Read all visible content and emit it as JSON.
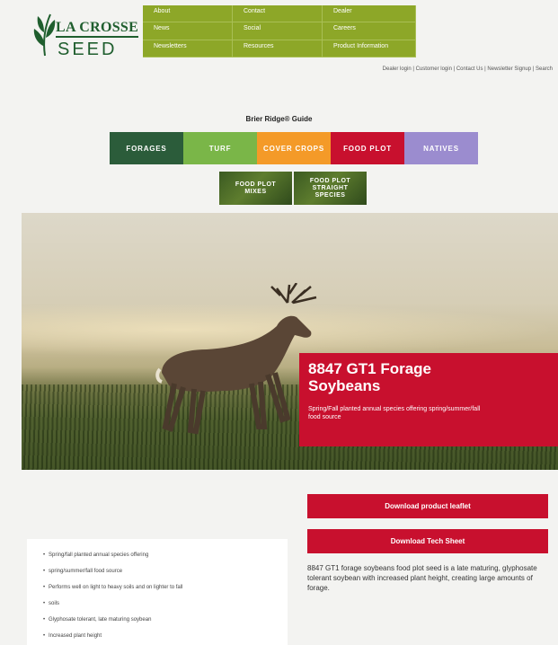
{
  "brand": {
    "logo_line1": "LA CROSSE",
    "logo_line2": "SEED"
  },
  "top_nav": [
    "About",
    "Contact",
    "Dealer",
    "News",
    "Social",
    "Careers",
    "Newsletters",
    "Resources",
    "Product Information"
  ],
  "utility_links": "Dealer login | Customer login | Contact Us | Newsletter Signup | Search",
  "guide": {
    "title": "Brier Ridge® Guide",
    "categories": [
      "Forages",
      "Turf",
      "Cover Crops",
      "Food Plot",
      "Natives"
    ],
    "subcategories": [
      "Food Plot Mixes",
      "Food Plot Straight Species"
    ]
  },
  "hero": {
    "title": "8847 GT1 Forage Soybeans",
    "subtitle": "Spring/Fall planted annual species offering spring/summer/fall food source"
  },
  "buttons": {
    "leaflet": "Download product leaflet",
    "tech_sheet": "Download Tech Sheet"
  },
  "description": "8847 GT1 forage soybeans food plot seed is a late maturing, glyphosate tolerant soybean with increased plant height, creating large amounts of forage.",
  "features": [
    "Spring/fall planted annual species offering",
    "spring/summer/fall food source",
    "Performs well on light to heavy soils and on lighter to fall",
    "soils",
    "Glyphosate tolerant, late maturing soybean",
    "Increased plant height"
  ],
  "colors": {
    "nav_green": "#8da728",
    "brand_green": "#1f5e2e",
    "accent_red": "#c8102e"
  }
}
